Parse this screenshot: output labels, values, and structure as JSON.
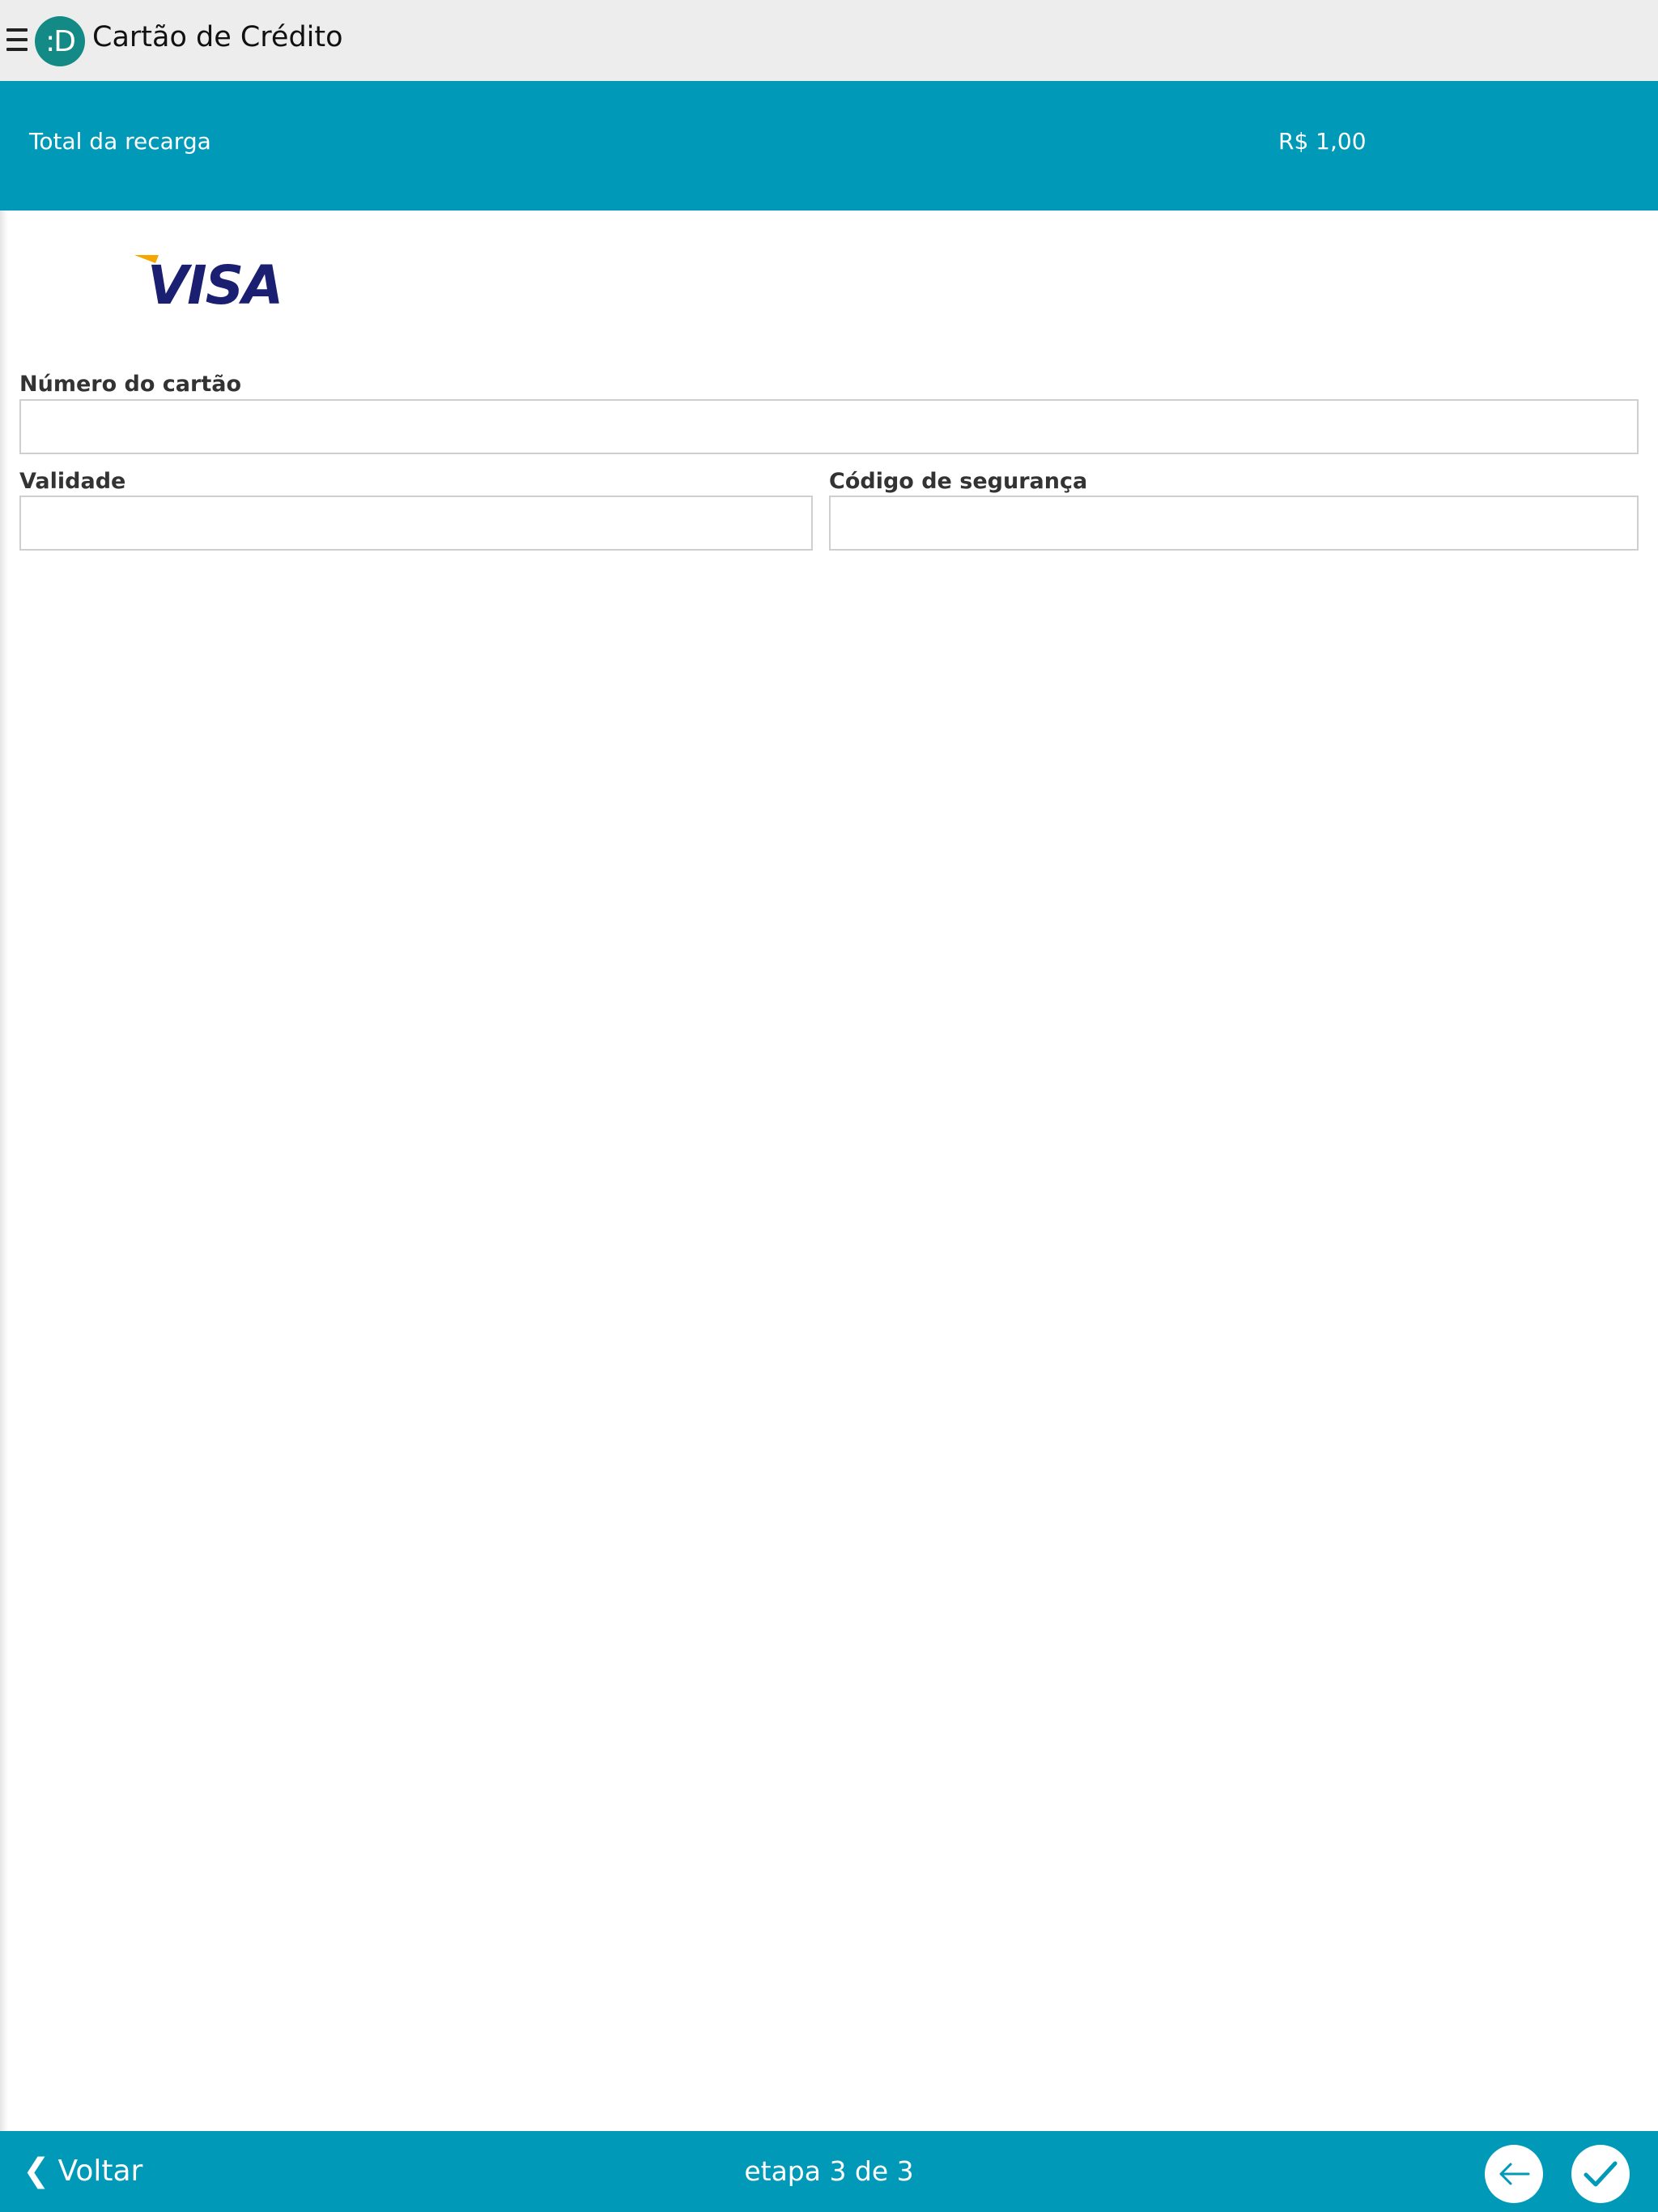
{
  "header": {
    "title": "Cartão de Crédito",
    "logo_text": ":D",
    "menu_icon": "hamburger-icon"
  },
  "summary": {
    "label": "Total da recarga",
    "value": "R$ 1,00"
  },
  "payment": {
    "card_brand": "VISA",
    "card_brand_colors": {
      "blue": "#1a1f71",
      "gold": "#f7a600"
    }
  },
  "form": {
    "card_number": {
      "label": "Número do cartão",
      "value": "",
      "placeholder": ""
    },
    "expiry": {
      "label": "Validade",
      "value": "",
      "placeholder": ""
    },
    "security_code": {
      "label": "Código de segurança",
      "value": "",
      "placeholder": ""
    }
  },
  "footer": {
    "back_label": "Voltar",
    "step_text": "etapa 3 de 3",
    "prev_icon": "arrow-left-icon",
    "confirm_icon": "checkmark-icon"
  },
  "colors": {
    "accent": "#0099b8",
    "topbar": "#ededed",
    "logo": "#138a86"
  }
}
